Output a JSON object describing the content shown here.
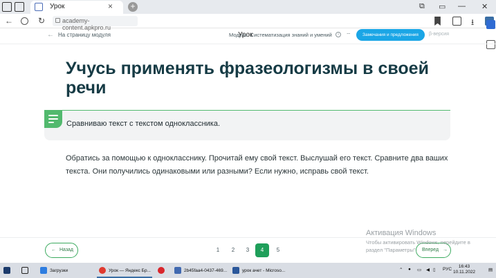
{
  "browser": {
    "tab_title": "Урок",
    "tab_close": "×",
    "new_tab": "+",
    "url": "academy-content.apkpro.ru",
    "page_title": "Урок",
    "window_controls": [
      "⧉",
      "▭",
      "—",
      "✕"
    ]
  },
  "header": {
    "back_label": "На страницу модуля",
    "back_arrow": "←",
    "module_label": "Модуль: Систематизация знаний и умений",
    "feedback_button": "Замечания и предложения",
    "beta_label": "β-версия"
  },
  "lesson": {
    "title": "Учусь применять фразеологизмы в своей речи",
    "task_title": "Сравниваю текст с текстом одноклассника.",
    "instruction": "Обратись за помощью к однокласснику. Прочитай ему свой текст. Выслушай его текст. Сравните два ваших текста. Они получились одинаковыми или разными? Если нужно, исправь свой текст."
  },
  "pagination": {
    "prev_label": "Назад",
    "prev_arrow": "←",
    "next_label": "Вперед",
    "next_arrow": "→",
    "pages": [
      "1",
      "2",
      "3",
      "4",
      "5"
    ],
    "current_index": 3
  },
  "watermark": {
    "title": "Активация Windows",
    "line1": "Чтобы активировать Windows, перейдите в",
    "line2": "раздел \"Параметры\"."
  },
  "taskbar": {
    "downloads": "Загрузки",
    "browser_window": "Урок — Яндекс Бр...",
    "file_window": "2b45faa4-0437-469...",
    "word_window": "урок ачет - Microso...",
    "language": "РУС",
    "time": "16:43",
    "date": "10.11.2022"
  },
  "colors": {
    "accent_green": "#52b96e",
    "page_active": "#1f9f5a",
    "feedback_blue": "#1ba6e6",
    "title_dark": "#163b45"
  }
}
